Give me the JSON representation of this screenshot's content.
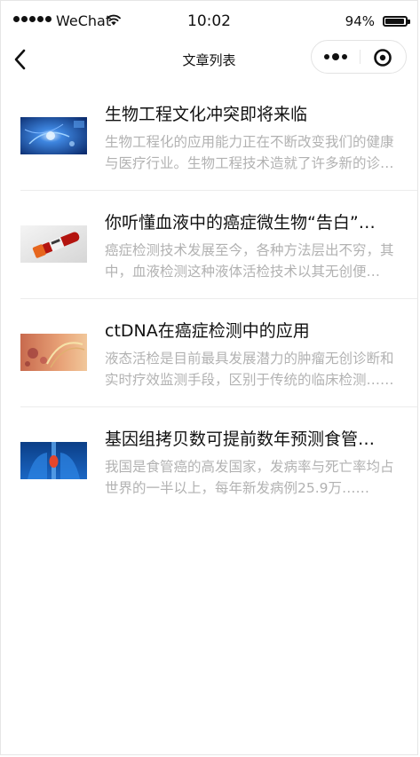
{
  "status_bar": {
    "carrier": "WeChat",
    "time": "10:02",
    "battery_percent": "94%",
    "battery_level": 0.94,
    "signal_bars": 5
  },
  "nav": {
    "title": "文章列表",
    "back_icon": "chevron-left-icon",
    "more_icon": "more-dots-icon",
    "close_icon": "target-circle-icon"
  },
  "articles": [
    {
      "title": "生物工程文化冲突即将来临",
      "summary": "生物工程化的应用能力正在不断改变我们的健康与医疗行业。生物工程技术造就了许多新的诊疗方法……",
      "thumb": "biotech-image"
    },
    {
      "title": "你听懂血液中的癌症微生物“告白”了吗",
      "summary": "癌症检测技术发展至今，各种方法层出不穷，其中，血液检测这种液体活检技术以其无创便捷……",
      "thumb": "blood-tube-image"
    },
    {
      "title": "ctDNA在癌症检测中的应用",
      "summary": "液态活检是目前最具发展潜力的肿瘤无创诊断和实时疗效监测手段，区别于传统的临床检测……",
      "thumb": "dna-cells-image"
    },
    {
      "title": "基因组拷贝数可提前数年预测食管癌风险",
      "summary": "我国是食管癌的高发国家，发病率与死亡率均占世界的一半以上，每年新发病例25.9万……",
      "thumb": "esophagus-image"
    }
  ],
  "colors": {
    "title_text": "#111111",
    "summary_text": "#b2b2b2",
    "divider": "#ececec"
  }
}
